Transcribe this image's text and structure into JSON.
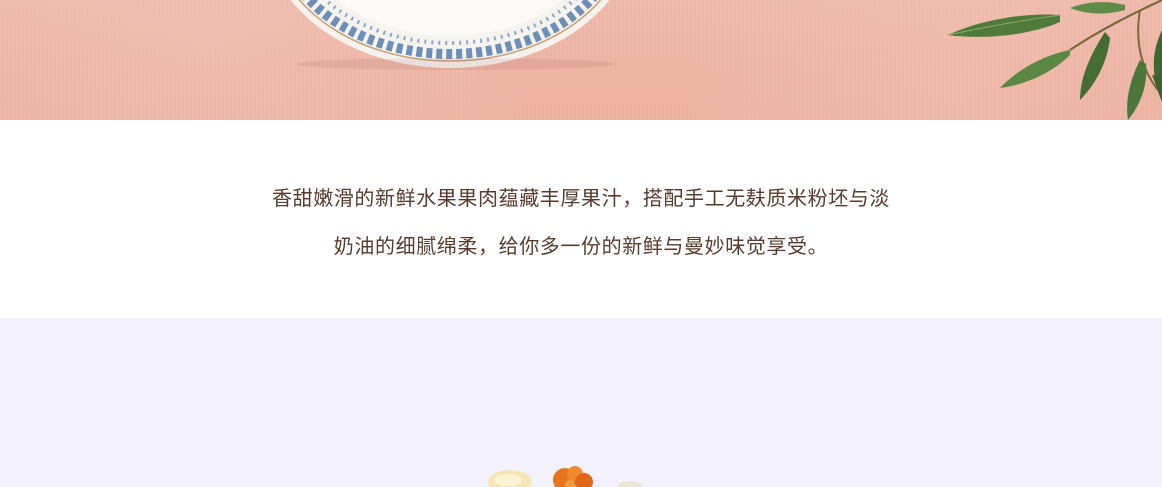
{
  "description": {
    "line1": "香甜嫩滑的新鲜水果果肉蕴藏丰厚果汁，搭配手工无麸质米粉坯与淡",
    "line2": "奶油的细腻绵柔，给你多一份的新鲜与曼妙味觉享受。"
  },
  "colors": {
    "hero_background": "#efb4a4",
    "text": "#5a3b2e",
    "lower_background": "#f3f2fc"
  }
}
